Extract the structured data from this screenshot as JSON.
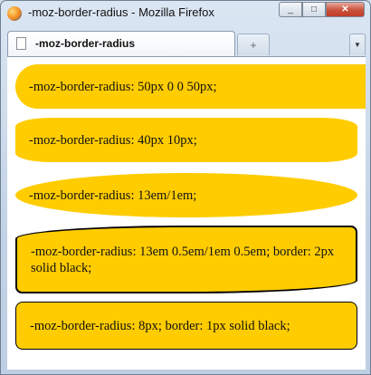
{
  "window": {
    "title": "-moz-border-radius - Mozilla Firefox",
    "app_icon": "firefox-icon",
    "controls": {
      "minimize": "_",
      "maximize": "□",
      "close": "✕"
    }
  },
  "tabs": {
    "active_tab_label": "-moz-border-radius",
    "page_icon": "document-icon",
    "new_tab_glyph": "+",
    "list_tabs_glyph": "▼"
  },
  "content": {
    "boxes": [
      {
        "text": "-moz-border-radius: 50px 0 0 50px;"
      },
      {
        "text": "-moz-border-radius: 40px 10px;"
      },
      {
        "text": "-moz-border-radius: 13em/1em;"
      },
      {
        "text": "-moz-border-radius: 13em 0.5em/1em 0.5em; border: 2px solid black;"
      },
      {
        "text": "-moz-border-radius: 8px; border: 1px solid black;"
      }
    ],
    "box_color": "#ffcc00"
  }
}
